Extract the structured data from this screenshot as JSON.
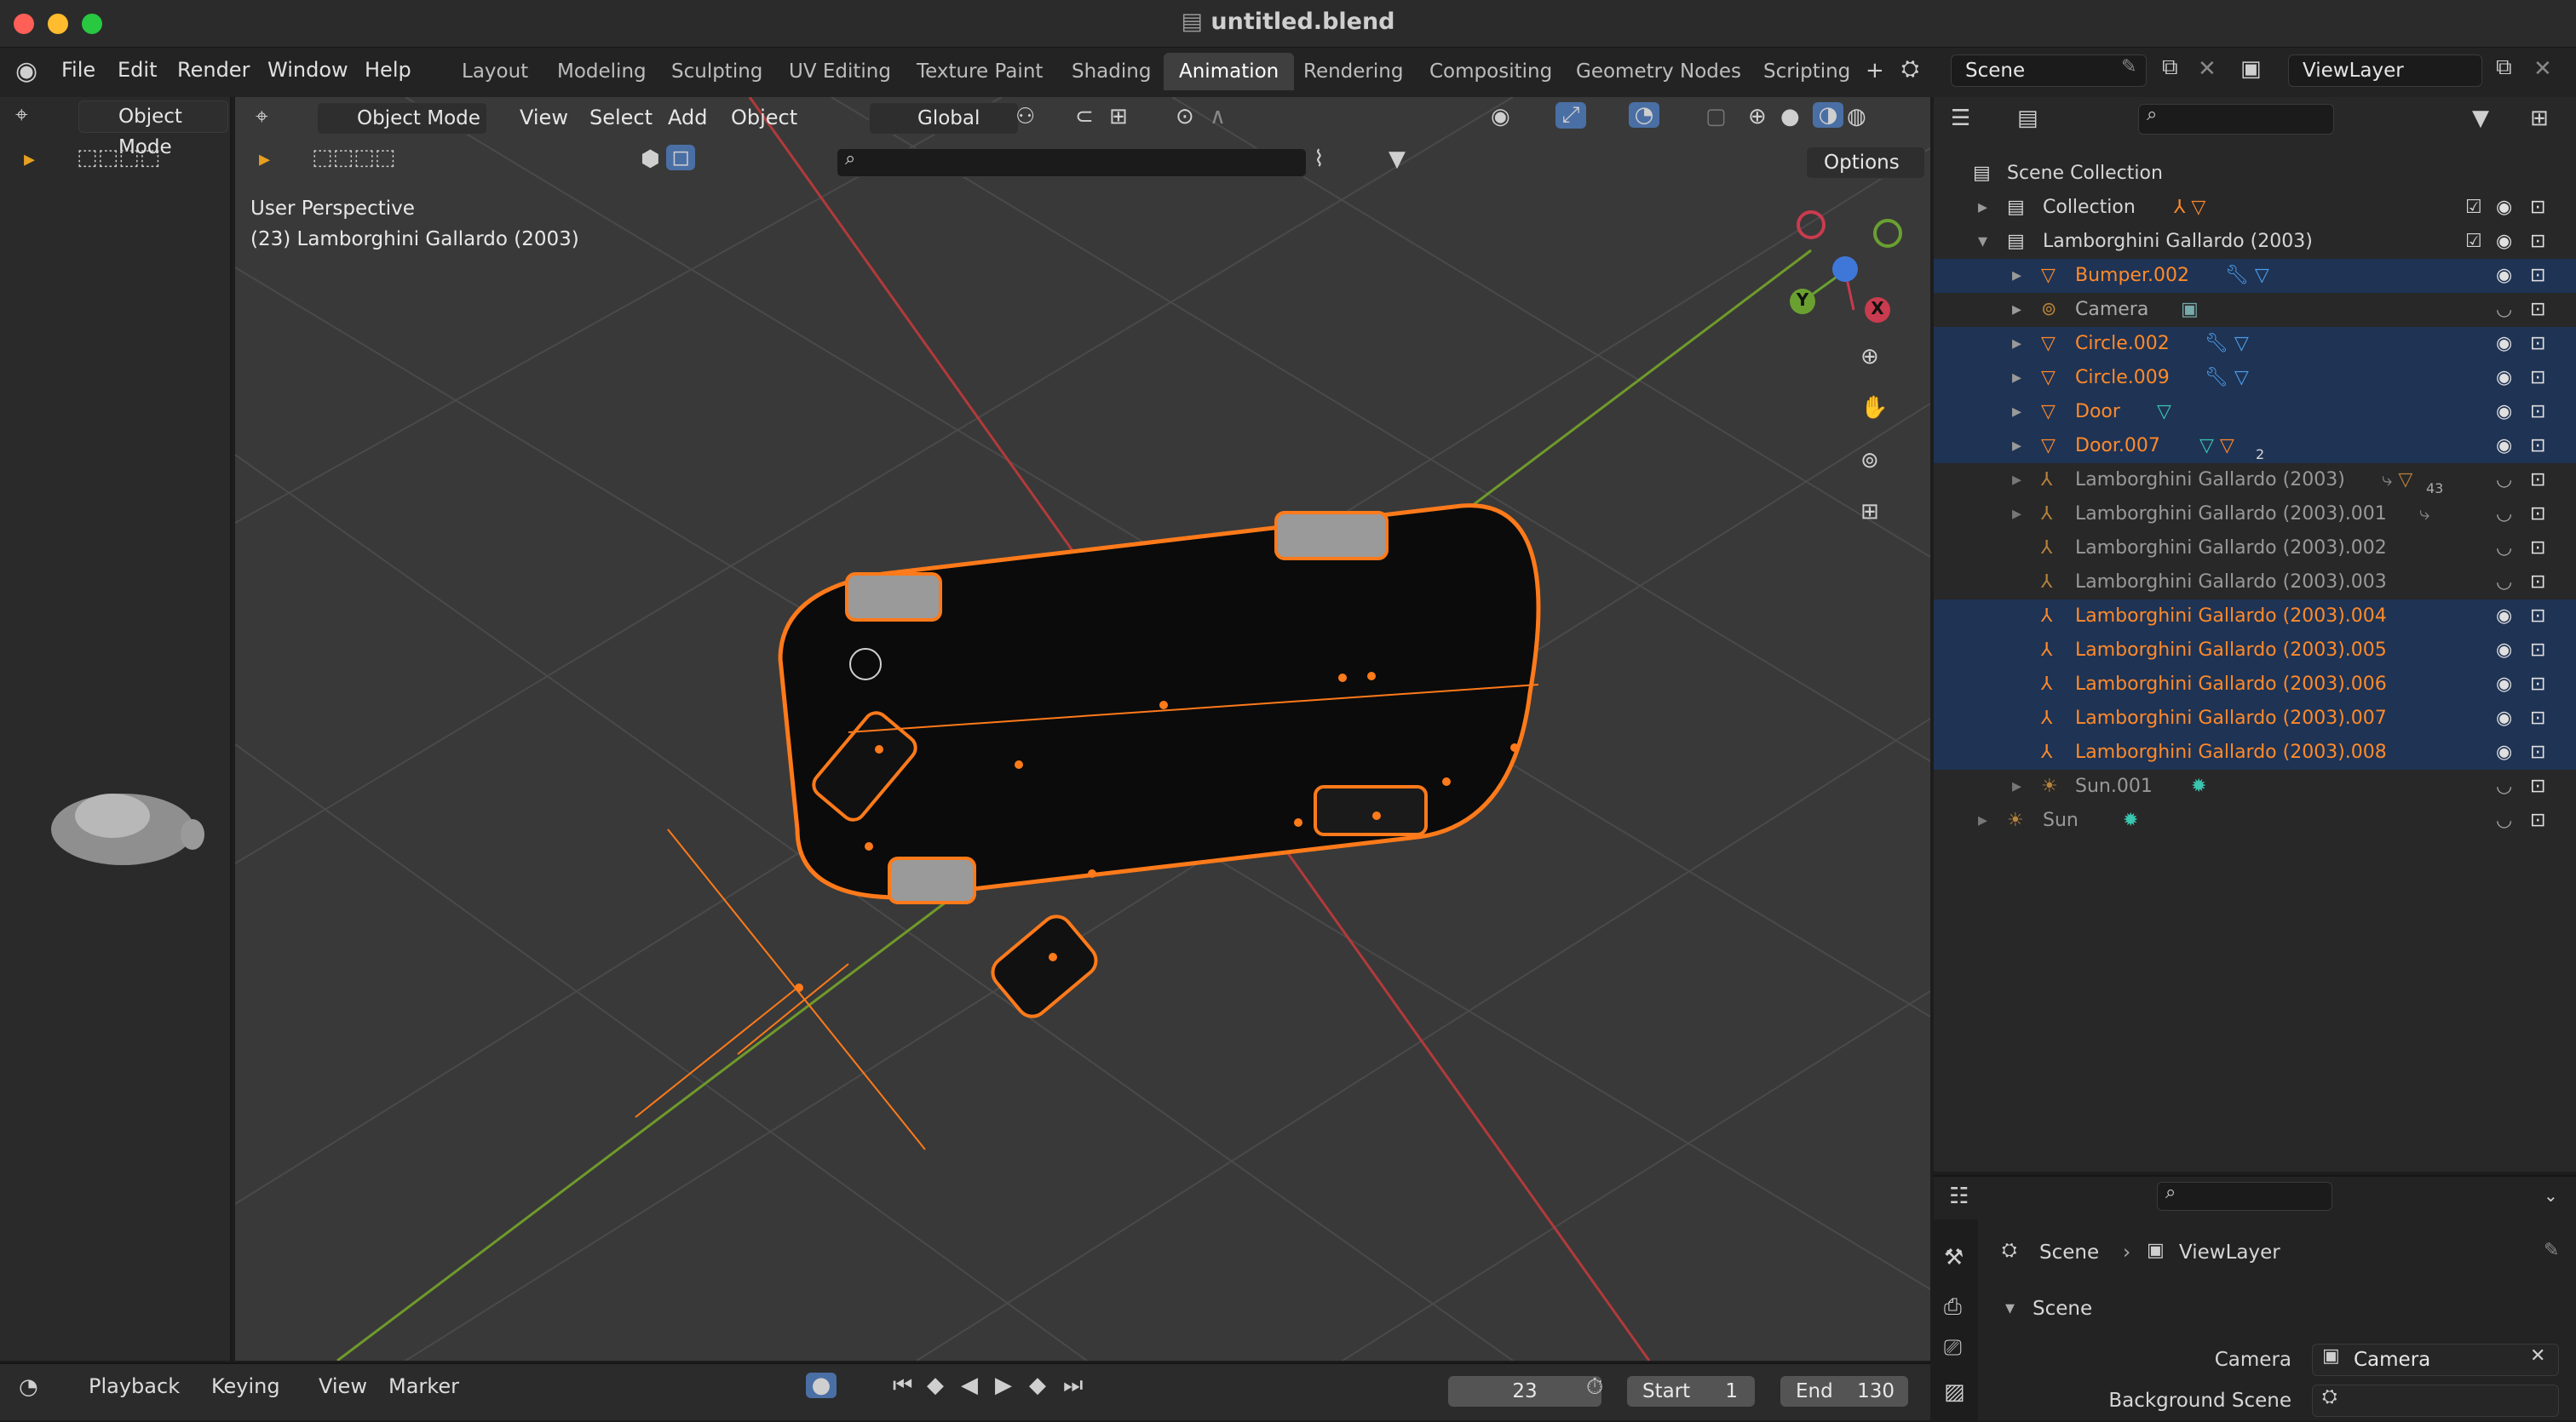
{
  "window": {
    "title": "untitled.blend"
  },
  "menu": [
    "File",
    "Edit",
    "Render",
    "Window",
    "Help"
  ],
  "workspaces": [
    {
      "label": "Layout",
      "active": false
    },
    {
      "label": "Modeling",
      "active": false
    },
    {
      "label": "Sculpting",
      "active": false
    },
    {
      "label": "UV Editing",
      "active": false
    },
    {
      "label": "Texture Paint",
      "active": false
    },
    {
      "label": "Shading",
      "active": false
    },
    {
      "label": "Animation",
      "active": true
    },
    {
      "label": "Rendering",
      "active": false
    },
    {
      "label": "Compositing",
      "active": false
    },
    {
      "label": "Geometry Nodes",
      "active": false
    },
    {
      "label": "Scripting",
      "active": false
    }
  ],
  "scene_selector": {
    "value": "Scene"
  },
  "viewlayer_selector": {
    "value": "ViewLayer"
  },
  "left_panel": {
    "mode": "Object Mode"
  },
  "viewport": {
    "mode": "Object Mode",
    "menus": [
      "View",
      "Select",
      "Add",
      "Object"
    ],
    "transform_orientation": "Global",
    "options_label": "Options",
    "overlay_line1": "User Perspective",
    "overlay_line2": "(23) Lamborghini Gallardo (2003)",
    "gizmo_labels": {
      "x": "X",
      "y": "Y"
    }
  },
  "outliner": {
    "root": "Scene Collection",
    "rows": [
      {
        "name": "Collection",
        "type": "collection",
        "selected": false,
        "highlight": false
      },
      {
        "name": "Lamborghini Gallardo (2003)",
        "type": "collection",
        "selected": false,
        "highlight": false
      },
      {
        "name": "Bumper.002",
        "type": "mesh",
        "selected": true,
        "highlight": true
      },
      {
        "name": "Camera",
        "type": "camera",
        "selected": false,
        "highlight": false
      },
      {
        "name": "Circle.002",
        "type": "mesh",
        "selected": true,
        "highlight": true
      },
      {
        "name": "Circle.009",
        "type": "mesh",
        "selected": true,
        "highlight": true
      },
      {
        "name": "Door",
        "type": "mesh",
        "selected": true,
        "highlight": false
      },
      {
        "name": "Door.007",
        "type": "mesh",
        "selected": true,
        "highlight": true
      },
      {
        "name": "Lamborghini Gallardo (2003)",
        "type": "empty",
        "selected": false,
        "highlight": false
      },
      {
        "name": "Lamborghini Gallardo (2003).001",
        "type": "empty",
        "selected": false,
        "highlight": false
      },
      {
        "name": "Lamborghini Gallardo (2003).002",
        "type": "empty",
        "selected": false,
        "highlight": false
      },
      {
        "name": "Lamborghini Gallardo (2003).003",
        "type": "empty",
        "selected": false,
        "highlight": false
      },
      {
        "name": "Lamborghini Gallardo (2003).004",
        "type": "empty",
        "selected": true,
        "highlight": true
      },
      {
        "name": "Lamborghini Gallardo (2003).005",
        "type": "empty",
        "selected": true,
        "highlight": true
      },
      {
        "name": "Lamborghini Gallardo (2003).006",
        "type": "empty",
        "selected": true,
        "highlight": true
      },
      {
        "name": "Lamborghini Gallardo (2003).007",
        "type": "empty",
        "selected": true,
        "highlight": true
      },
      {
        "name": "Lamborghini Gallardo (2003).008",
        "type": "empty",
        "selected": true,
        "highlight": true
      },
      {
        "name": "Sun.001",
        "type": "light",
        "selected": false,
        "highlight": false
      },
      {
        "name": "Sun",
        "type": "light",
        "selected": false,
        "highlight": false
      }
    ],
    "badges": {
      "door007": "2",
      "lambo": "43"
    }
  },
  "properties": {
    "breadcrumb": [
      "Scene",
      "ViewLayer"
    ],
    "section": "Scene",
    "camera_label": "Camera",
    "camera_value": "Camera",
    "background_label": "Background Scene"
  },
  "timeline": {
    "menus": [
      "Playback",
      "Keying",
      "View",
      "Marker"
    ],
    "current_frame": "23",
    "start_label": "Start",
    "start_value": "1",
    "end_label": "End",
    "end_value": "130"
  },
  "colors": {
    "selection": "#ff7a1a",
    "highlight_row": "#1f3354",
    "active_blue": "#4a9ce8"
  }
}
